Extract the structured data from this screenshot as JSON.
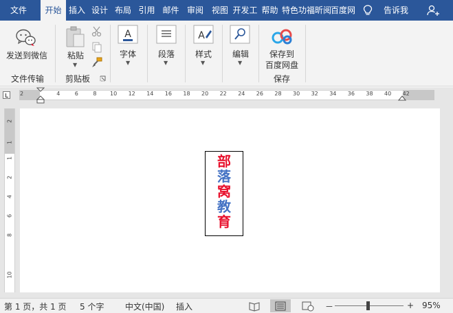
{
  "tabs": [
    "文件",
    "开始",
    "插入",
    "设计",
    "布局",
    "引用",
    "邮件",
    "审阅",
    "视图",
    "开发工",
    "帮助",
    "特色功",
    "福昕阅",
    "百度网"
  ],
  "tell_me": "告诉我",
  "ribbon": {
    "wechat": {
      "label": "发送到微信",
      "group": "文件传输"
    },
    "clipboard": {
      "paste": "粘贴",
      "group": "剪贴板"
    },
    "font": {
      "label": "字体"
    },
    "paragraph": {
      "label": "段落"
    },
    "styles": {
      "label": "样式"
    },
    "editing": {
      "label": "编辑"
    },
    "baidu": {
      "label_line1": "保存到",
      "label_line2": "百度网盘",
      "group": "保存"
    }
  },
  "ruler": {
    "ticks": [
      "2",
      "2",
      "4",
      "6",
      "8",
      "10",
      "12",
      "14",
      "16",
      "18",
      "20",
      "22",
      "24",
      "26",
      "28",
      "30",
      "32",
      "34",
      "36",
      "38",
      "40",
      "42"
    ],
    "vticks": [
      "2",
      "1",
      "1",
      "2",
      "4",
      "6",
      "8",
      "10"
    ]
  },
  "document": {
    "chars": [
      {
        "text": "部",
        "color": "#e8112d"
      },
      {
        "text": "落",
        "color": "#4472c4"
      },
      {
        "text": "窝",
        "color": "#e8112d"
      },
      {
        "text": "教",
        "color": "#4472c4"
      },
      {
        "text": "育",
        "color": "#e8112d"
      }
    ]
  },
  "status": {
    "page": "第 1 页，共 1 页",
    "words": "5 个字",
    "language": "中文(中国)",
    "mode": "插入",
    "zoom_minus": "－",
    "zoom_plus": "+",
    "zoom": "95%"
  },
  "icons": {
    "wechat": "wechat-send-icon",
    "paste": "clipboard-paste-icon",
    "cut": "scissors-icon",
    "copy": "copy-icon",
    "format_painter": "format-painter-icon",
    "font": "font-a-icon",
    "paragraph": "paragraph-lines-icon",
    "styles": "styles-brush-icon",
    "editing": "search-magnifier-icon",
    "baidu": "baidu-netdisk-icon",
    "tell_me": "lightbulb-icon",
    "user": "add-user-icon"
  },
  "colors": {
    "ribbon_blue": "#2b579a",
    "red_text": "#e8112d",
    "blue_text": "#4472c4"
  }
}
